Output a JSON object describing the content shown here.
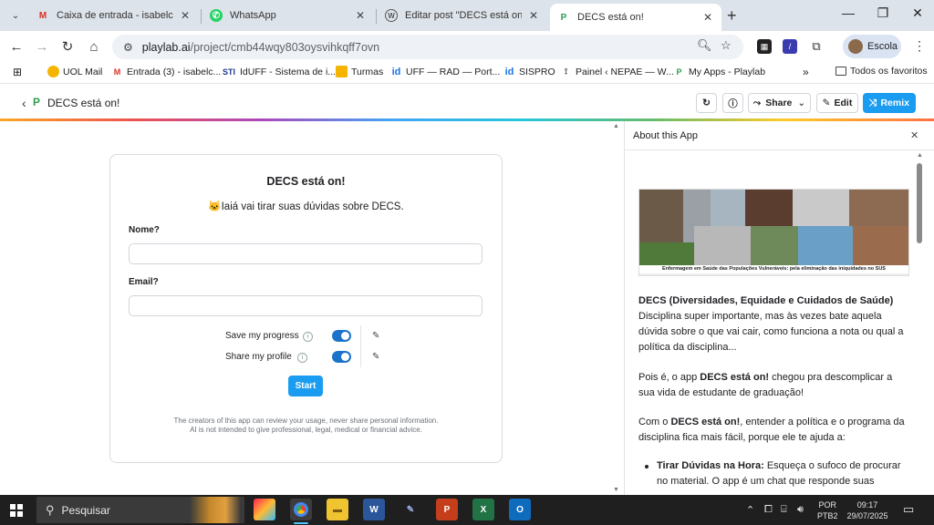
{
  "browser": {
    "tabs": [
      {
        "title": "Caixa de entrada - isabelcruz@",
        "icon": "gmail-icon"
      },
      {
        "title": "WhatsApp",
        "icon": "whatsapp-icon"
      },
      {
        "title": "Editar post \"DECS está on!\" ‹ N",
        "icon": "wordpress-icon"
      },
      {
        "title": "DECS está on!",
        "icon": "playlab-icon"
      }
    ],
    "address": {
      "host": "playlab.ai",
      "path": "/project/cmb44wqy803oysvihkqff7ovn"
    },
    "profile": "Escola",
    "bookmarks": [
      "UOL Mail",
      "Entrada (3) - isabelc...",
      "IdUFF - Sistema de i...",
      "Turmas",
      "UFF — RAD — Port...",
      "SISPRO",
      "Painel ‹ NEPAE — W...",
      "My Apps - Playlab"
    ],
    "bookmarks_folder": "Todos os favoritos"
  },
  "header": {
    "title": "DECS está on!",
    "share_label": "Share",
    "edit_label": "Edit",
    "remix_label": "Remix"
  },
  "form": {
    "title": "DECS está on!",
    "subtitle": "🐱Iaiá vai tirar suas dúvidas sobre DECS.",
    "name_label": "Nome?",
    "email_label": "Email?",
    "save_progress_label": "Save my progress",
    "share_profile_label": "Share my profile",
    "save_progress_on": true,
    "share_profile_on": true,
    "start_label": "Start",
    "disclaimer_line1": "The creators of this app can review your usage, never share personal information.",
    "disclaimer_line2": "AI is not intended to give professional, legal, medical or financial advice."
  },
  "about": {
    "title": "About this App",
    "banner_caption": "Enfermagem em Saúde das Populações Vulneráveis: pela eliminação das iniquidades no SUS",
    "p1_bold": "DECS (Diversidades, Equidade e Cuidados de Saúde)",
    "p1_rest": "Disciplina super importante, mas às vezes bate aquela dúvida sobre o que vai cair, como funciona a nota ou qual a política da disciplina...",
    "p2_a": "Pois é, o app ",
    "p2_bold": "DECS está on!",
    "p2_b": " chegou pra descomplicar a sua vida de estudante de graduação!",
    "p3_a": "Com o ",
    "p3_bold": "DECS está on!",
    "p3_b": ", entender a política e o programa da disciplina fica mais fácil, porque ele te ajuda a:",
    "bullet1_bold": "Tirar Dúvidas na Hora:",
    "bullet1_rest": " Esqueça o sufoco de procurar no material. O app é um chat que responde suas"
  },
  "taskbar": {
    "search_placeholder": "Pesquisar",
    "lang_line1": "POR",
    "lang_line2": "PTB2",
    "time": "09:17",
    "date": "29/07/2025"
  }
}
